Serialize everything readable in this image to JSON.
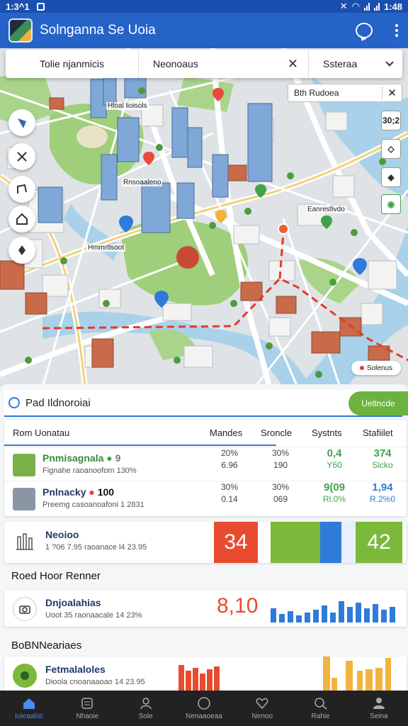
{
  "status": {
    "time": "1:3^1",
    "clock": "1:48"
  },
  "app": {
    "title": "Solnganna Se Uoia"
  },
  "search": {
    "location": "Tolie njanmicis",
    "destination": "Neonoaus",
    "filter": "Ssteraa"
  },
  "map": {
    "route_chip": "Bth Rudoea",
    "labels": {
      "north": "Hloal lioisols",
      "center": "Rnsoaaleno",
      "east": "Eanresfivdo",
      "west": "Hmmrtlsoot"
    },
    "scale": "30;2",
    "legend": "Solenus",
    "accent": "#2563c9",
    "route_color": "#e23b2b"
  },
  "panel": {
    "title": "Pad Ildnoroiai",
    "legend_pill": "Ueltncde"
  },
  "table": {
    "columns": [
      "Rom Uonatau",
      "Mandes",
      "Sroncle",
      "Systnts",
      "Stafiilet"
    ],
    "rows": [
      {
        "name": "Pnmisagnala",
        "badge": "9",
        "sub": "Fignahe raoanoofom 130%",
        "c1": [
          "20%",
          "6.96"
        ],
        "c2": [
          "30%",
          "190"
        ],
        "c3": [
          "0,4",
          "Y60"
        ],
        "c4": [
          "374",
          "Slcko"
        ],
        "thumb": "#7bb04a"
      },
      {
        "name": "Pnlnacky",
        "badge": "100",
        "sub": "Preemg casoanoafoni 1 2831",
        "c1": [
          "30%",
          "0.14"
        ],
        "c2": [
          "30%",
          "069"
        ],
        "c3": [
          "9(09",
          "Rl.0%"
        ],
        "c4": [
          "1,94",
          "R.2%0"
        ],
        "thumb": "#8a96a3"
      }
    ]
  },
  "list": [
    {
      "name": "Neoioo",
      "sub": "1 ?06 7.95 raoanace l4 23.95",
      "stat": "34",
      "stat2": "42"
    },
    {
      "name": "Dnjoalahias",
      "sub": "Uoot 35 raonaacale 14 23%",
      "stat": "8,10"
    },
    {
      "name": "Fetmalaloles",
      "sub": "Dioola cnoanaaoao 14 23.95"
    }
  ],
  "sections": {
    "s1": "Roed Hoor Renner",
    "s2": "BoBNNeariaes"
  },
  "nav": [
    "Ioieaaloc",
    "Nhaoie",
    "Sole",
    "Nenaaoeaa",
    "Nenoo",
    "Rahie",
    "Seina"
  ]
}
